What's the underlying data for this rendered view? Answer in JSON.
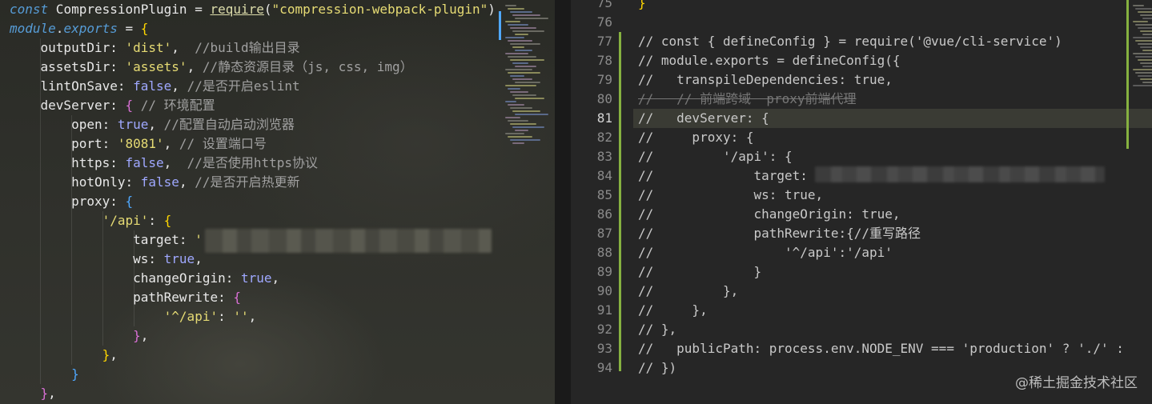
{
  "left_editor": {
    "lines": [
      [
        {
          "t": "const",
          "c": "tok-kw"
        },
        {
          "t": " CompressionPlugin = ",
          "c": "tok-id"
        },
        {
          "t": "require",
          "c": "tok-fn"
        },
        {
          "t": "(",
          "c": "tok-pun"
        },
        {
          "t": "\"compression-webpack-plugin\"",
          "c": "tok-str"
        },
        {
          "t": ")",
          "c": "tok-pun"
        }
      ],
      [
        {
          "t": "module",
          "c": "tok-kw"
        },
        {
          "t": ".",
          "c": "tok-pun"
        },
        {
          "t": "exports",
          "c": "tok-kw"
        },
        {
          "t": " = ",
          "c": "tok-pun"
        },
        {
          "t": "{",
          "c": "tok-brace1"
        }
      ],
      [
        {
          "t": "    outputDir: ",
          "c": "tok-prop"
        },
        {
          "t": "'dist'",
          "c": "tok-str"
        },
        {
          "t": ",  ",
          "c": "tok-pun"
        },
        {
          "t": "//build输出目录",
          "c": "tok-cm"
        }
      ],
      [
        {
          "t": "    assetsDir: ",
          "c": "tok-prop"
        },
        {
          "t": "'assets'",
          "c": "tok-str"
        },
        {
          "t": ", ",
          "c": "tok-pun"
        },
        {
          "t": "//静态资源目录（js, css, img）",
          "c": "tok-cm"
        }
      ],
      [
        {
          "t": "    lintOnSave: ",
          "c": "tok-prop"
        },
        {
          "t": "false",
          "c": "tok-bool"
        },
        {
          "t": ", ",
          "c": "tok-pun"
        },
        {
          "t": "//是否开启eslint",
          "c": "tok-cm"
        }
      ],
      [
        {
          "t": "    devServer: ",
          "c": "tok-prop"
        },
        {
          "t": "{",
          "c": "tok-brace2"
        },
        {
          "t": " // 环境配置",
          "c": "tok-cm"
        }
      ],
      [
        {
          "t": "        open: ",
          "c": "tok-prop"
        },
        {
          "t": "true",
          "c": "tok-bool"
        },
        {
          "t": ", ",
          "c": "tok-pun"
        },
        {
          "t": "//配置自动启动浏览器",
          "c": "tok-cm"
        }
      ],
      [
        {
          "t": "        port: ",
          "c": "tok-prop"
        },
        {
          "t": "'8081'",
          "c": "tok-str"
        },
        {
          "t": ", ",
          "c": "tok-pun"
        },
        {
          "t": "// 设置端口号",
          "c": "tok-cm"
        }
      ],
      [
        {
          "t": "        https: ",
          "c": "tok-prop"
        },
        {
          "t": "false",
          "c": "tok-bool"
        },
        {
          "t": ",  ",
          "c": "tok-pun"
        },
        {
          "t": "//是否使用https协议",
          "c": "tok-cm"
        }
      ],
      [
        {
          "t": "        hotOnly: ",
          "c": "tok-prop"
        },
        {
          "t": "false",
          "c": "tok-bool"
        },
        {
          "t": ", ",
          "c": "tok-pun"
        },
        {
          "t": "//是否开启热更新",
          "c": "tok-cm"
        }
      ],
      [
        {
          "t": "        proxy: ",
          "c": "tok-prop"
        },
        {
          "t": "{",
          "c": "tok-brace3"
        }
      ],
      [
        {
          "t": "            ",
          "c": "tok-pun"
        },
        {
          "t": "'/api'",
          "c": "tok-str"
        },
        {
          "t": ": ",
          "c": "tok-pun"
        },
        {
          "t": "{",
          "c": "tok-brace1"
        }
      ],
      [
        {
          "t": "                target: ",
          "c": "tok-prop"
        },
        {
          "t": "'",
          "c": "tok-str"
        }
      ],
      [
        {
          "t": "                ws: ",
          "c": "tok-prop"
        },
        {
          "t": "true",
          "c": "tok-bool"
        },
        {
          "t": ",",
          "c": "tok-pun"
        }
      ],
      [
        {
          "t": "                changeOrigin: ",
          "c": "tok-prop"
        },
        {
          "t": "true",
          "c": "tok-bool"
        },
        {
          "t": ",",
          "c": "tok-pun"
        }
      ],
      [
        {
          "t": "                pathRewrite: ",
          "c": "tok-prop"
        },
        {
          "t": "{",
          "c": "tok-brace2"
        }
      ],
      [
        {
          "t": "                    ",
          "c": "tok-pun"
        },
        {
          "t": "'^/api'",
          "c": "tok-str"
        },
        {
          "t": ": ",
          "c": "tok-pun"
        },
        {
          "t": "''",
          "c": "tok-str"
        },
        {
          "t": ",",
          "c": "tok-pun"
        }
      ],
      [
        {
          "t": "                ",
          "c": "tok-pun"
        },
        {
          "t": "}",
          "c": "tok-brace2"
        },
        {
          "t": ",",
          "c": "tok-pun"
        }
      ],
      [
        {
          "t": "            ",
          "c": "tok-pun"
        },
        {
          "t": "}",
          "c": "tok-brace1"
        },
        {
          "t": ",",
          "c": "tok-pun"
        }
      ],
      [
        {
          "t": "        ",
          "c": "tok-pun"
        },
        {
          "t": "}",
          "c": "tok-brace3"
        }
      ],
      [
        {
          "t": "    ",
          "c": "tok-pun"
        },
        {
          "t": "}",
          "c": "tok-brace2"
        },
        {
          "t": ",",
          "c": "tok-pun"
        }
      ]
    ]
  },
  "right_editor": {
    "line_numbers": [
      "75",
      "76",
      "77",
      "78",
      "79",
      "80",
      "81",
      "82",
      "83",
      "84",
      "85",
      "86",
      "87",
      "88",
      "89",
      "90",
      "91",
      "92",
      "93",
      "94"
    ],
    "active_line": "81",
    "lines": [
      {
        "text": "}",
        "style": "tok-brace1"
      },
      {
        "text": "",
        "style": "rc"
      },
      {
        "text": "// const { defineConfig } = require('@vue/cli-service')",
        "style": "rc"
      },
      {
        "text": "// module.exports = defineConfig({",
        "style": "rc"
      },
      {
        "text": "//   transpileDependencies: true,",
        "style": "rc"
      },
      {
        "text": "//   // 前端跨域  proxy前端代理",
        "style": "rc-strike"
      },
      {
        "text": "//   devServer: {",
        "style": "rc"
      },
      {
        "text": "//     proxy: {",
        "style": "rc"
      },
      {
        "text": "//         '/api': {",
        "style": "rc"
      },
      {
        "text": "//             target:",
        "style": "rc"
      },
      {
        "text": "//             ws: true,",
        "style": "rc"
      },
      {
        "text": "//             changeOrigin: true,",
        "style": "rc"
      },
      {
        "text": "//             pathRewrite:{//重写路径",
        "style": "rc"
      },
      {
        "text": "//                 '^/api':'/api'",
        "style": "rc"
      },
      {
        "text": "//             }",
        "style": "rc"
      },
      {
        "text": "//         },",
        "style": "rc"
      },
      {
        "text": "//     },",
        "style": "rc"
      },
      {
        "text": "// },",
        "style": "rc"
      },
      {
        "text": "//   publicPath: process.env.NODE_ENV === 'production' ? './' :",
        "style": "rc"
      },
      {
        "text": "// })",
        "style": "rc"
      }
    ]
  },
  "watermark": "@稀土掘金技术社区",
  "colors": {
    "git_added": "#86b140",
    "scroll_indicator": "#4fa8ff",
    "current_line": "#3a3b34"
  }
}
